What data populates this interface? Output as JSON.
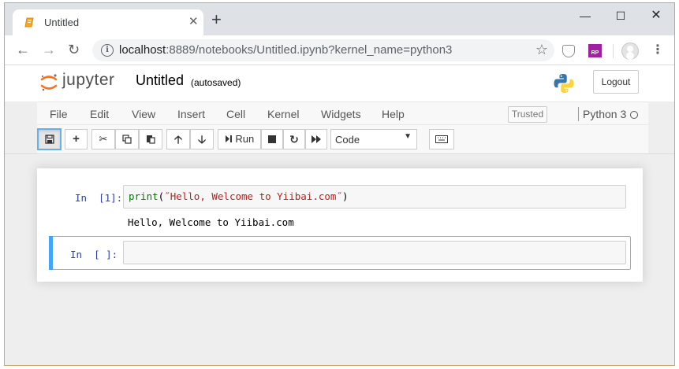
{
  "browser": {
    "tab_title": "Untitled",
    "tab_close": "✕",
    "new_tab": "+",
    "window_controls": {
      "minimize": "—",
      "maximize": "☐",
      "close": "✕"
    },
    "url_host": "localhost",
    "url_rest": ":8889/notebooks/Untitled.ipynb?kernel_name=python3",
    "icons": [
      "back-arrow-icon",
      "forward-arrow-icon",
      "reload-icon",
      "info-icon",
      "star-icon",
      "shield-extension-icon",
      "rp-extension-icon",
      "profile-icon",
      "menu-icon"
    ],
    "ext_rp_label": "RP"
  },
  "jupyter": {
    "logo_text": "jupyter",
    "notebook_name": "Untitled",
    "save_status": "(autosaved)",
    "logout_label": "Logout",
    "menu": [
      "File",
      "Edit",
      "View",
      "Insert",
      "Cell",
      "Kernel",
      "Widgets",
      "Help"
    ],
    "trusted_label": "Trusted",
    "kernel_name": "Python 3",
    "toolbar": {
      "run_label": "Run",
      "cell_type": "Code",
      "buttons": [
        "save-icon",
        "add-cell-icon",
        "cut-icon",
        "copy-icon",
        "paste-icon",
        "move-up-icon",
        "move-down-icon",
        "run-icon",
        "stop-icon",
        "restart-icon",
        "fast-forward-icon",
        "keyboard-icon"
      ]
    }
  },
  "cells": [
    {
      "prompt": "In  [1]:",
      "code_fn": "print",
      "code_open": "(",
      "code_str": "˝Hello, Welcome to Yiibai.com˝",
      "code_close": ")",
      "output": "Hello, Welcome to Yiibai.com"
    },
    {
      "prompt": "In  [ ]:",
      "code": ""
    }
  ],
  "colors": {
    "jupyter_orange": "#f37626",
    "prompt_blue": "#303f9f",
    "selected_cell_bar": "#42a5f5",
    "keyword_green": "#008000",
    "string_red": "#ba2121"
  }
}
